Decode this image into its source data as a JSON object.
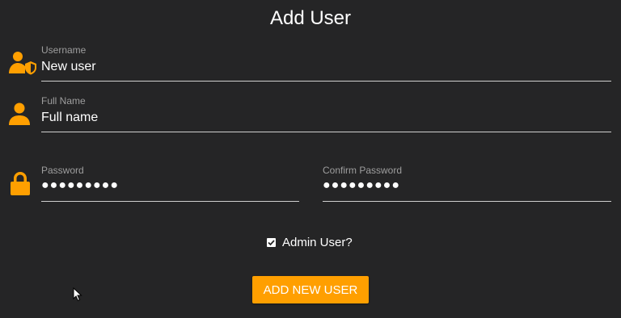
{
  "dialog": {
    "title": "Add User"
  },
  "form": {
    "username": {
      "label": "Username",
      "value": "New user",
      "icon": "user-shield-icon"
    },
    "full_name": {
      "label": "Full Name",
      "value": "Full name",
      "icon": "user-icon"
    },
    "password": {
      "label": "Password",
      "value": "●●●●●●●●●",
      "icon": "lock-icon"
    },
    "confirm_password": {
      "label": "Confirm Password",
      "value": "●●●●●●●●●"
    },
    "admin_checkbox": {
      "label": "Admin User?",
      "checked": true
    },
    "submit_label": "ADD NEW USER"
  },
  "colors": {
    "background": "#252526",
    "accent": "#ff9f00",
    "label": "#9e9e9e",
    "text": "#ffffff",
    "underline": "#cfcfcf"
  }
}
